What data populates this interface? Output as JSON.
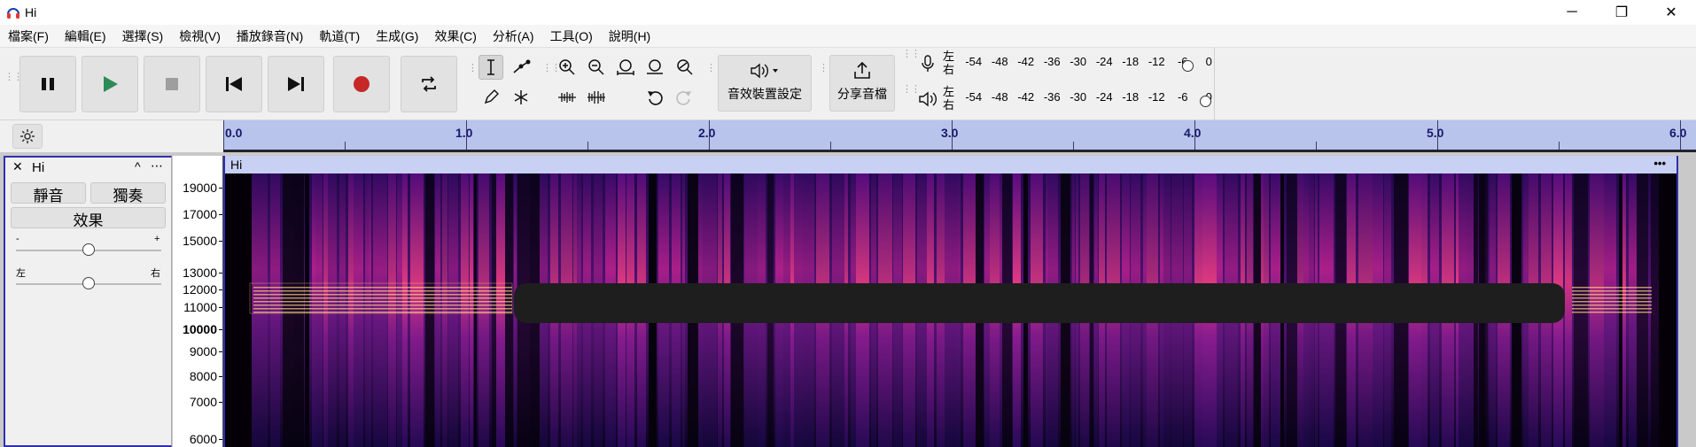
{
  "window": {
    "title": "Hi",
    "minimize_glyph": "─",
    "restore_glyph": "❐",
    "close_glyph": "✕"
  },
  "menu": [
    "檔案(F)",
    "編輯(E)",
    "選擇(S)",
    "檢視(V)",
    "播放錄音(N)",
    "軌道(T)",
    "生成(G)",
    "效果(C)",
    "分析(A)",
    "工具(O)",
    "說明(H)"
  ],
  "toolbar": {
    "audio_setup_label": "音效裝置設定",
    "share_label": "分享音檔"
  },
  "meters": {
    "record": {
      "channel_top": "左",
      "channel_bottom": "右",
      "scale": [
        "-54",
        "-48",
        "-42",
        "-36",
        "-30",
        "-24",
        "-18",
        "-12",
        "-6",
        "0"
      ]
    },
    "playback": {
      "channel_top": "左",
      "channel_bottom": "右",
      "scale": [
        "-54",
        "-48",
        "-42",
        "-36",
        "-30",
        "-24",
        "-18",
        "-12",
        "-6",
        "0"
      ]
    }
  },
  "ruler": {
    "labels": [
      "0.0",
      "1.0",
      "2.0",
      "3.0",
      "4.0",
      "5.0",
      "6.0"
    ]
  },
  "track": {
    "name": "Hi",
    "close_glyph": "✕",
    "collapse_glyph": "^",
    "menu_glyph": "⋯",
    "mute_label": "靜音",
    "solo_label": "獨奏",
    "effects_label": "效果",
    "gain": {
      "min_label": "-",
      "max_label": "+",
      "value": 0.5
    },
    "pan": {
      "left_label": "左",
      "right_label": "右",
      "value": 0.5
    }
  },
  "freq_axis": {
    "labels": [
      "19000",
      "17000",
      "15000",
      "13000",
      "12000",
      "11000",
      "10000",
      "9000",
      "8000",
      "7000",
      "6000"
    ],
    "bold_label": "10000"
  },
  "clip": {
    "name": "Hi",
    "menu_glyph": "•••"
  },
  "colors": {
    "ruler_bg": "#b8c4ec",
    "selection_border": "#2f2fb0",
    "record_button": "#c62828",
    "play_button": "#2e8b57"
  }
}
